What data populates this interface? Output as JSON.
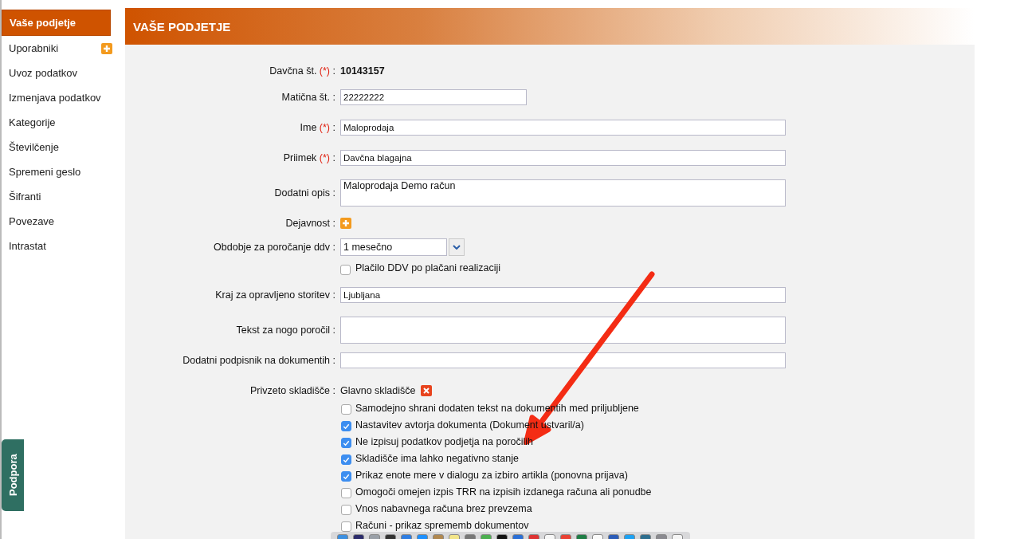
{
  "sidebar": {
    "items": [
      {
        "label": "Vaše podjetje",
        "selected": true
      },
      {
        "label": "Uporabniki",
        "selected": false,
        "add": true
      },
      {
        "label": "Uvoz podatkov",
        "selected": false
      },
      {
        "label": "Izmenjava podatkov",
        "selected": false
      },
      {
        "label": "Kategorije",
        "selected": false
      },
      {
        "label": "Številčenje",
        "selected": false
      },
      {
        "label": "Spremeni geslo",
        "selected": false
      },
      {
        "label": "Šifranti",
        "selected": false
      },
      {
        "label": "Povezave",
        "selected": false
      },
      {
        "label": "Intrastat",
        "selected": false
      }
    ],
    "support_tab": "Podpora"
  },
  "header": {
    "title": "VAŠE PODJETJE"
  },
  "form": {
    "rows": [
      {
        "kind": "static",
        "label": "Davčna št.",
        "required": "(*)",
        "colon": ":",
        "value": "10143157"
      },
      {
        "kind": "text",
        "label": "Matična št.",
        "colon": ":",
        "value": "22222222",
        "short": true
      },
      {
        "kind": "text",
        "label": "Ime",
        "required": "(*)",
        "colon": ":",
        "value": "Maloprodaja"
      },
      {
        "kind": "text",
        "label": "Priimek",
        "required": "(*)",
        "colon": ":",
        "value": "Davčna blagajna"
      },
      {
        "kind": "textarea",
        "label": "Dodatni opis",
        "colon": ":",
        "value": "Maloprodaja Demo račun"
      },
      {
        "kind": "add",
        "label": "Dejavnost",
        "colon": ":"
      },
      {
        "kind": "select",
        "label": "Obdobje za poročanje ddv",
        "colon": ":",
        "value": "1 mesečno"
      },
      {
        "kind": "checkbox",
        "text": "Plačilo DDV po plačani realizaciji",
        "checked": false
      },
      {
        "kind": "text",
        "label": "Kraj za opravljeno storitev",
        "colon": ":",
        "value": "Ljubljana"
      },
      {
        "kind": "textarea",
        "label": "Tekst za nogo poročil",
        "colon": ":"
      },
      {
        "kind": "text",
        "label": "Dodatni podpisnik na dokumentih",
        "colon": ":"
      },
      {
        "kind": "tag",
        "label": "Privzeto skladišče",
        "colon": ":",
        "value": "Glavno skladišče"
      }
    ],
    "options": [
      {
        "text": "Samodejno shrani dodaten tekst na dokumentih med priljubljene",
        "checked": false
      },
      {
        "text": "Nastavitev avtorja dokumenta (Dokument ustvaril/a)",
        "checked": true
      },
      {
        "text": "Ne izpisuj podatkov podjetja na poročilih",
        "checked": true
      },
      {
        "text": "Skladišče ima lahko negativno stanje",
        "checked": true
      },
      {
        "text": "Prikaz enote mere v dialogu za izbiro artikla (ponovna prijava)",
        "checked": true
      },
      {
        "text": "Omogoči omejen izpis TRR na izpisih izdanega računa ali ponudbe",
        "checked": false
      },
      {
        "text": "Vnos nabavnega računa brez prevzema",
        "checked": false
      },
      {
        "text": "Računi - prikaz sprememb dokumentov",
        "checked": false
      }
    ]
  }
}
